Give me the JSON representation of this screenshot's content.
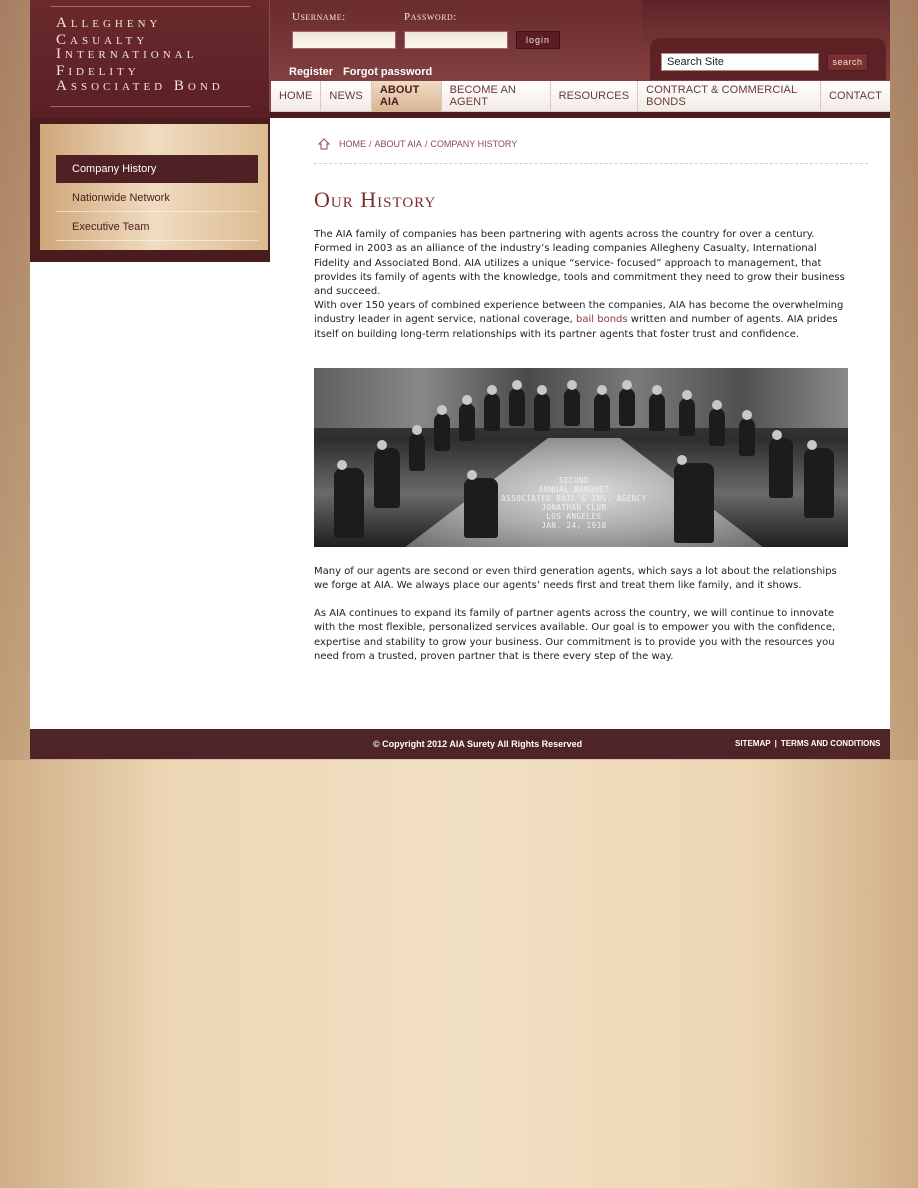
{
  "logo": {
    "line1": "Allegheny Casualty",
    "line2": "International Fidelity",
    "line3": "Associated Bond"
  },
  "login": {
    "username_label": "Username:",
    "password_label": "Password:",
    "username_value": "",
    "password_value": "",
    "login_label": "login",
    "register_label": "Register",
    "forgot_label": "Forgot password"
  },
  "search": {
    "placeholder": "Search Site",
    "button_label": "search"
  },
  "nav": {
    "items": [
      {
        "label": "HOME",
        "active": false
      },
      {
        "label": "NEWS",
        "active": false
      },
      {
        "label": "ABOUT AIA",
        "active": true
      },
      {
        "label": "BECOME AN AGENT",
        "active": false
      },
      {
        "label": "RESOURCES",
        "active": false
      },
      {
        "label": "CONTRACT & COMMERCIAL BONDS",
        "active": false
      },
      {
        "label": "CONTACT",
        "active": false
      }
    ]
  },
  "sidebar": {
    "items": [
      {
        "label": "Company History",
        "active": true
      },
      {
        "label": "Nationwide Network",
        "active": false
      },
      {
        "label": "Executive Team",
        "active": false
      }
    ]
  },
  "breadcrumb": {
    "home": "HOME",
    "section": "ABOUT AIA",
    "page": "COMPANY HISTORY",
    "separator": "/"
  },
  "main": {
    "title": "Our History",
    "p1": "The AIA family of companies has been partnering with agents across the country for over a century. Formed in 2003 as an alliance of the industry’s leading companies Allegheny Casualty, International Fidelity and Associated Bond.   AIA utilizes a unique “service- focused” approach to management, that provides its family of agents with the knowledge, tools and commitment they need to grow their business and succeed.",
    "p2_before": "With over 150 years of combined experience between the companies, AIA has become the overwhelming industry leader in agent service, national coverage, ",
    "p2_link": "bail bonds",
    "p2_after": " written and number of agents. AIA prides itself on building long-term relationships with its partner agents that foster trust and confidence.",
    "photo_caption": "SECOND\nANNUAL BANQUET\nASSOCIATED BAIL & INS. AGENCY\nJONATHAN CLUB\nLOS ANGELES\nJAN. 24, 1938",
    "p3": "Many of our agents are second or even third generation agents, which says a lot about the relationships we forge at AIA. We always place our agents’ needs first and treat them like family, and it shows.",
    "p4": "As AIA continues to expand its family of partner agents across the country, we will continue to innovate with the most flexible, personalized services available. Our goal is to empower you with the confidence, expertise and stability to grow your business. Our commitment is to provide you with the resources you need from a trusted, proven partner that is there every step of the way."
  },
  "footer": {
    "copyright": "© Copyright 2012 AIA Surety All Rights Reserved",
    "sitemap": "SITEMAP",
    "separator": "|",
    "terms": "TERMS AND CONDITIONS"
  }
}
